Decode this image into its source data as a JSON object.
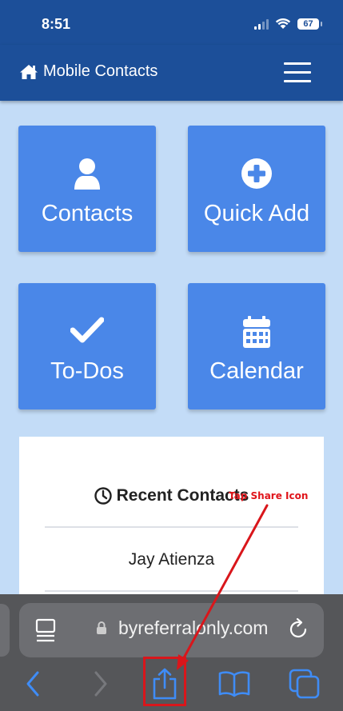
{
  "status_bar": {
    "time": "8:51",
    "battery": "67"
  },
  "navbar": {
    "brand": "Mobile Contacts"
  },
  "tiles": [
    {
      "label": "Contacts",
      "icon": "user-icon"
    },
    {
      "label": "Quick Add",
      "icon": "plus-circle-icon"
    },
    {
      "label": "To-Dos",
      "icon": "checkmark-icon"
    },
    {
      "label": "Calendar",
      "icon": "calendar-icon"
    }
  ],
  "recent_contacts": {
    "title": "Recent Contacts",
    "items": [
      "Jay Atienza"
    ]
  },
  "browser": {
    "url": "byreferralonly.com"
  },
  "annotation": {
    "text": "Tap Share Icon",
    "color": "#e0141a"
  },
  "colors": {
    "brand": "#1c4f99",
    "tile": "#4a87e8",
    "background": "#c3dcf7",
    "browser_accent": "#3f8cf6"
  }
}
